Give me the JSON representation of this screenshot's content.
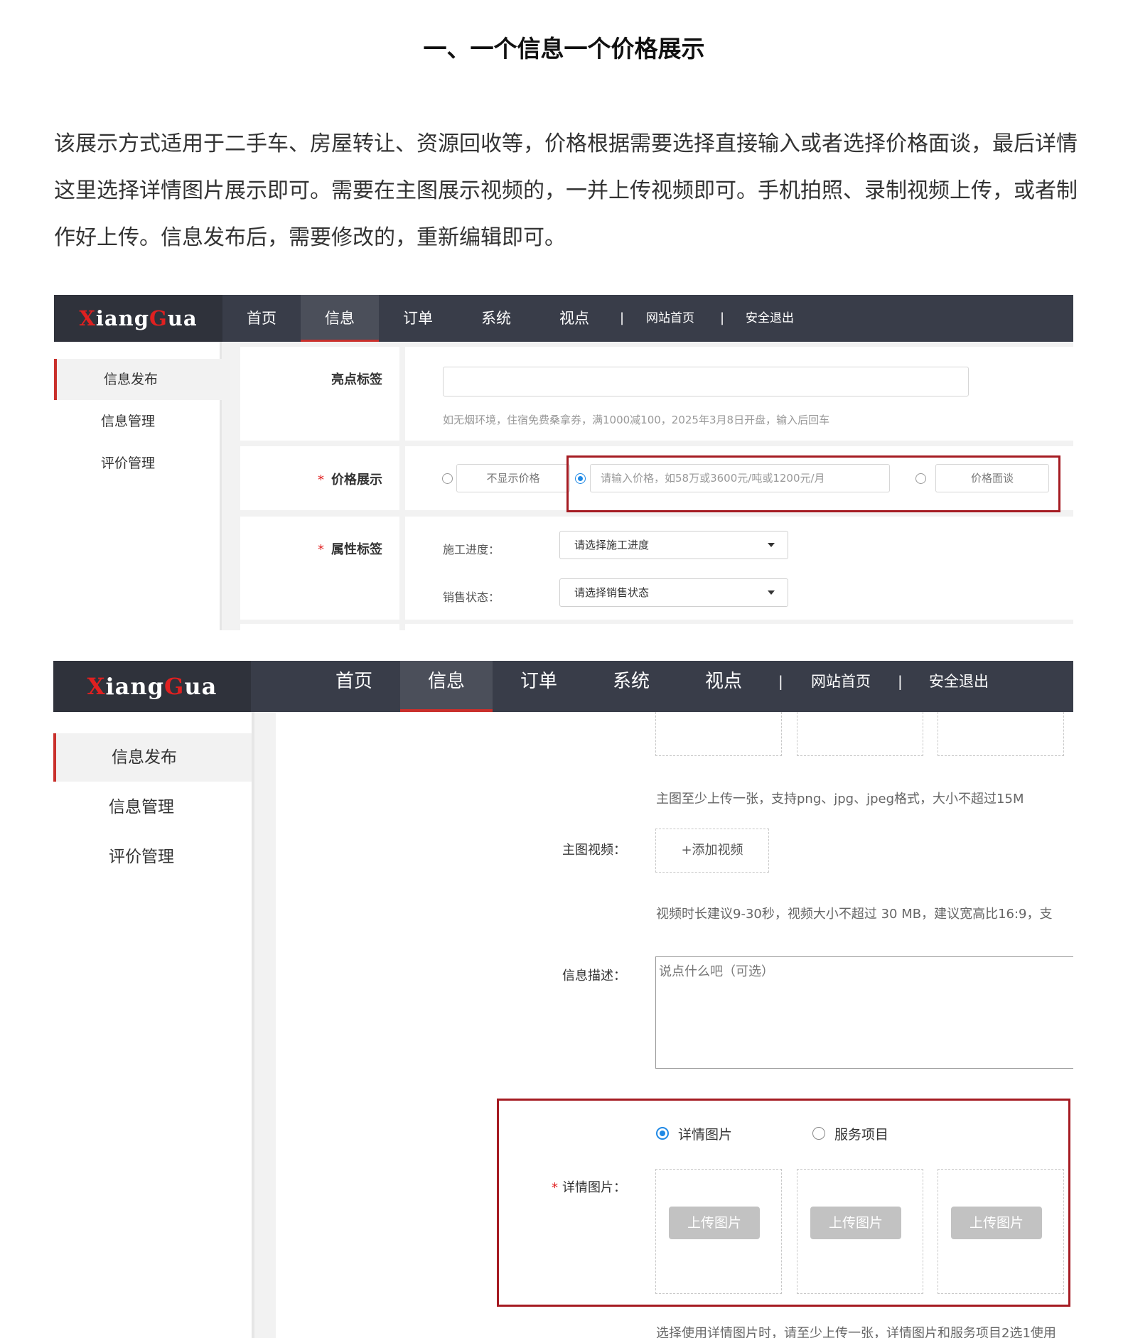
{
  "heading": "一、一个信息一个价格展示",
  "intro": "该展示方式适用于二手车、房屋转让、资源回收等，价格根据需要选择直接输入或者选择价格面谈，最后详情这里选择详情图片展示即可。需要在主图展示视频的，一并上传视频即可。手机拍照、录制视频上传，或者制作好上传。信息发布后，需要修改的，重新编辑即可。",
  "app": {
    "logo": {
      "part1": "X",
      "part2": "iang",
      "part3": "G",
      "part4": "ua"
    },
    "nav": [
      "首页",
      "信息",
      "订单",
      "系统",
      "视点"
    ],
    "nav_sep": "|",
    "nav_site": "网站首页",
    "nav_logout": "安全退出",
    "sidebar": [
      "信息发布",
      "信息管理",
      "评价管理"
    ]
  },
  "shot1": {
    "highlight_label": "亮点标签",
    "highlight_hint": "如无烟环境，住宿免费桑拿券，满1000减100，2025年3月8日开盘，输入后回车",
    "price_label": "价格展示",
    "price_required": "*",
    "price_opt_none": "不显示价格",
    "price_placeholder": "请输入价格，如58万或3600元/吨或1200元/月",
    "price_opt_negotiate": "价格面谈",
    "attr_label": "属性标签",
    "attr_required": "*",
    "progress_label": "施工进度：",
    "progress_select": "请选择施工进度",
    "sale_label": "销售状态：",
    "sale_select": "请选择销售状态"
  },
  "shot2": {
    "main_img_hint": "主图至少上传一张，支持png、jpg、jpeg格式，大小不超过15M",
    "video_label": "主图视频：",
    "video_btn": "+添加视频",
    "video_hint": "视频时长建议9-30秒，视频大小不超过 30 MB，建议宽高比16:9，支",
    "desc_label": "信息描述：",
    "desc_placeholder": "说点什么吧（可选）",
    "opt_detail": "详情图片",
    "opt_service": "服务项目",
    "detail_required": "*",
    "detail_label": "详情图片：",
    "upload_btn": "上传图片",
    "bottom_hint": "选择使用详情图片时，请至少上传一张，详情图片和服务项目2选1使用"
  }
}
